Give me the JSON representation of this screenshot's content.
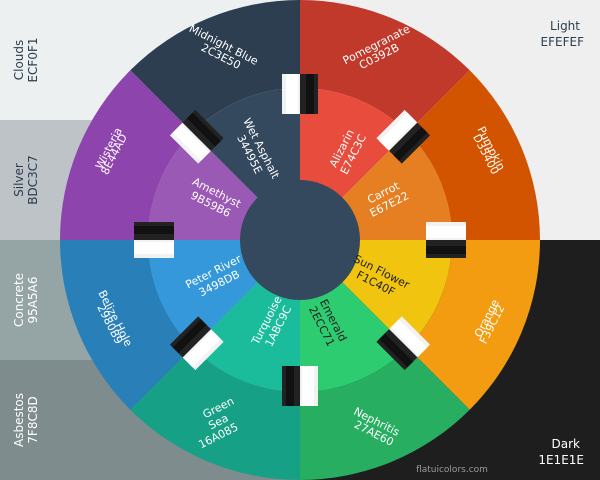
{
  "background": {
    "panels": [
      {
        "name": "Clouds",
        "hex": "ECF0F1",
        "color": "#ECF0F1",
        "text_color": "#2C3E50"
      },
      {
        "name": "Silver",
        "hex": "BDC3C7",
        "color": "#BDC3C7",
        "text_color": "#2C3E50"
      },
      {
        "name": "Concrete",
        "hex": "95A5A6",
        "color": "#95A5A6",
        "text_color": "#FFFFFF"
      },
      {
        "name": "Asbestos",
        "hex": "7F8C8D",
        "color": "#7F8C8D",
        "text_color": "#FFFFFF"
      }
    ],
    "light": {
      "name": "Light",
      "hex": "EFEFEF",
      "color": "#EFEFEF",
      "text_color": "#2C3E50"
    },
    "dark": {
      "name": "Dark",
      "hex": "1E1E1E",
      "color": "#1E1E1E",
      "text_color": "#FFFFFF"
    }
  },
  "outer_ring": [
    {
      "name": "Pomegranate",
      "hex": "C0392B",
      "color": "#C0392B"
    },
    {
      "name": "Pumpkin",
      "hex": "D35400",
      "color": "#D35400"
    },
    {
      "name": "Orange",
      "hex": "F39C12",
      "color": "#F39C12"
    },
    {
      "name": "Nephritis",
      "hex": "27AE60",
      "color": "#27AE60"
    },
    {
      "name": "Green Sea",
      "hex": "16A085",
      "color": "#16A085"
    },
    {
      "name": "Belize Hole",
      "hex": "2980B9",
      "color": "#2980B9"
    },
    {
      "name": "Wisteria",
      "hex": "8E44AD",
      "color": "#8E44AD"
    },
    {
      "name": "Midnight Blue",
      "hex": "2C3E50",
      "color": "#2C3E50"
    }
  ],
  "inner_ring": [
    {
      "name": "Alizarin",
      "hex": "E74C3C",
      "color": "#E74C3C"
    },
    {
      "name": "Carrot",
      "hex": "E67E22",
      "color": "#E67E22"
    },
    {
      "name": "Sun Flower",
      "hex": "F1C40F",
      "color": "#F1C40F"
    },
    {
      "name": "Emerald",
      "hex": "2ECC71",
      "color": "#2ECC71"
    },
    {
      "name": "Turquoise",
      "hex": "1ABC9C",
      "color": "#1ABC9C"
    },
    {
      "name": "Peter River",
      "hex": "3498DB",
      "color": "#3498DB"
    },
    {
      "name": "Amethyst",
      "hex": "9B59B6",
      "color": "#9B59B6"
    },
    {
      "name": "Wet Asphalt",
      "hex": "34495E",
      "color": "#34495E"
    }
  ],
  "center_disc_color": "#34495E",
  "watermark": "flatuicolors.com"
}
